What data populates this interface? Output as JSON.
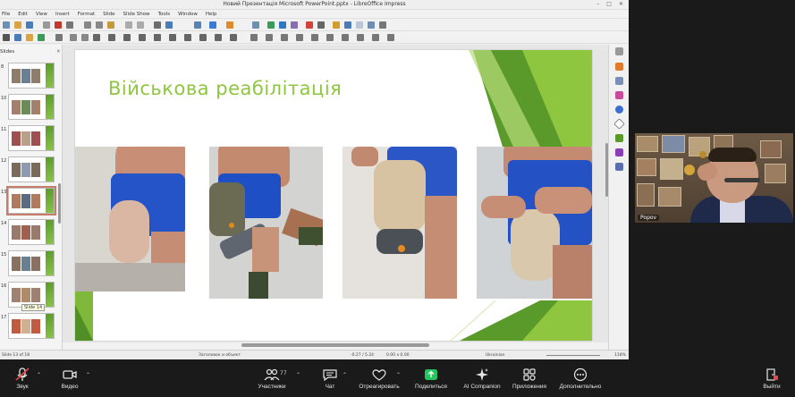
{
  "window": {
    "title": "Новий Презентація Microsoft PowerPoint.pptx - LibreOffice Impress",
    "controls": [
      "–",
      "□",
      "✕"
    ]
  },
  "menu": [
    "File",
    "Edit",
    "View",
    "Insert",
    "Format",
    "Slide",
    "Slide Show",
    "Tools",
    "Window",
    "Help"
  ],
  "slide_pane": {
    "header": "Slides",
    "close": "✕",
    "tooltip": "Slide 14",
    "items": [
      {
        "num": "8",
        "selected": false
      },
      {
        "num": "10",
        "selected": false
      },
      {
        "num": "11",
        "selected": false
      },
      {
        "num": "12",
        "selected": false
      },
      {
        "num": "13",
        "selected": true
      },
      {
        "num": "14",
        "selected": false
      },
      {
        "num": "15",
        "selected": false
      },
      {
        "num": "16",
        "selected": false
      },
      {
        "num": "17",
        "selected": false
      }
    ]
  },
  "slide": {
    "title": "Військова реабілітація"
  },
  "status_bar": {
    "slide_info": "Slide 13 of 18",
    "master": "Заголовок и объект",
    "position": "-0.27 / 5.24",
    "size": "0.00 x 0.00",
    "language": "Ukrainian",
    "zoom": "118%"
  },
  "participant": {
    "name": "Popov"
  },
  "meeting_bar": {
    "mute": "Звук",
    "video": "Видео",
    "participants": "Участники",
    "participants_count": "77",
    "chat": "Чат",
    "react": "Отреагировать",
    "share": "Поделиться",
    "ai": "AI Companion",
    "apps": "Приложения",
    "more": "Дополнительно",
    "leave": "Выйти"
  },
  "colors": {
    "accent_green": "#8ec63f",
    "share_green": "#22c55e",
    "mute_red": "#e5484d"
  }
}
